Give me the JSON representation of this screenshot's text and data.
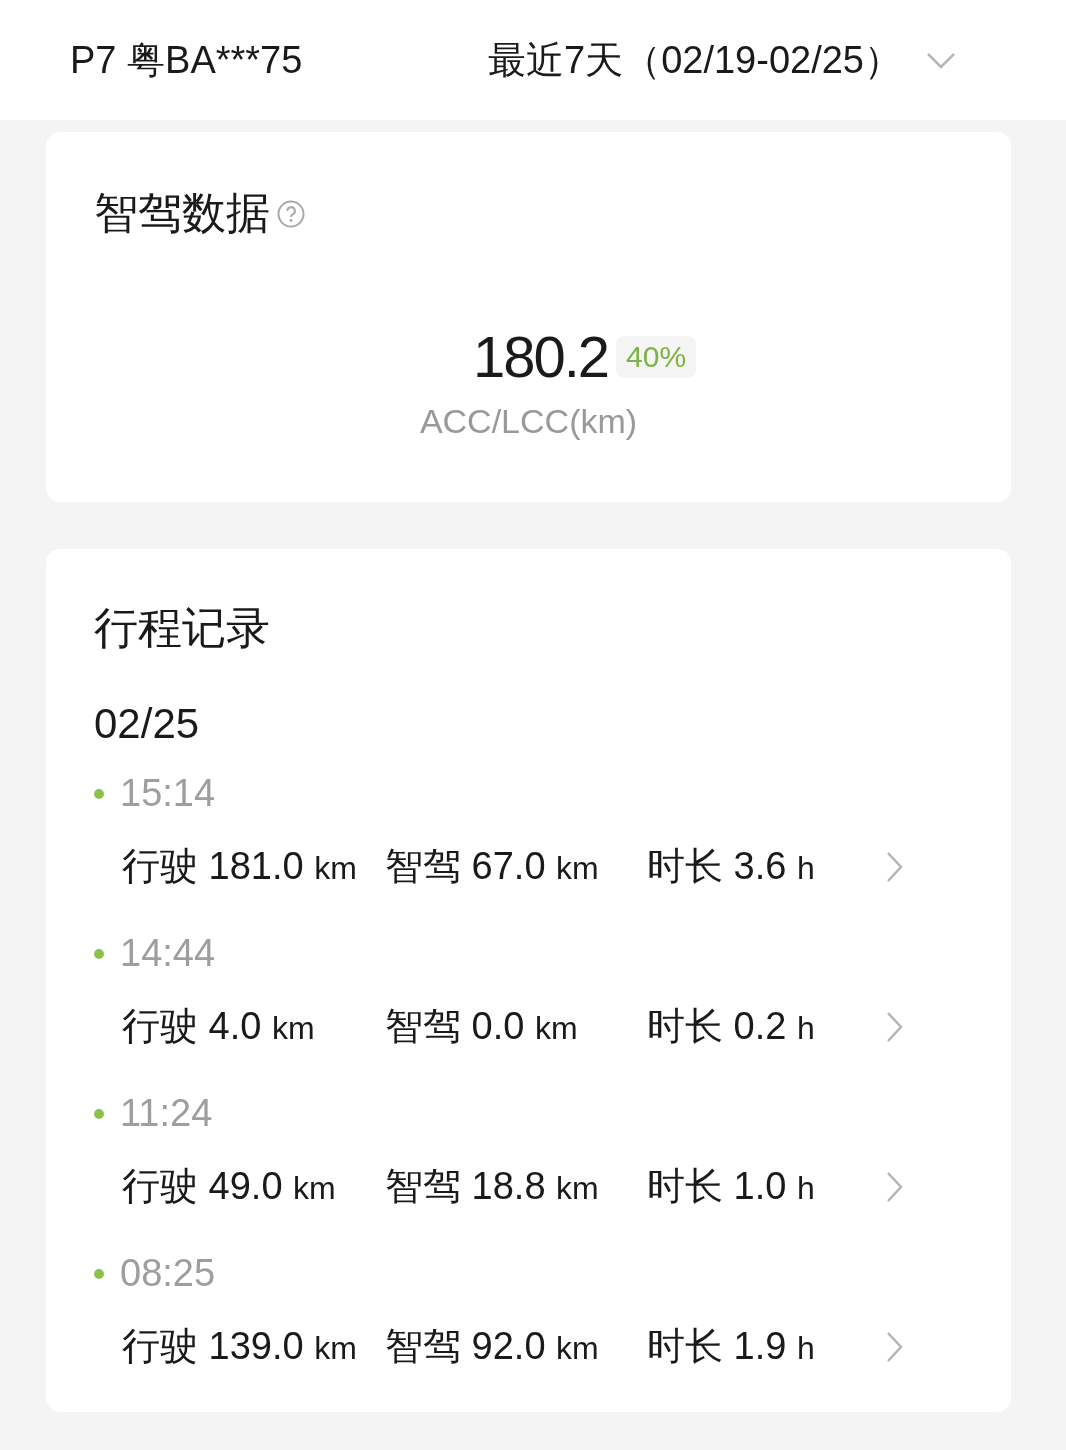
{
  "header": {
    "vehicle": "P7 粤BA***75",
    "period": "最近7天（02/19-02/25）"
  },
  "assist_card": {
    "title": "智驾数据",
    "value": "180.2",
    "percent": "40%",
    "caption": "ACC/LCC(km)"
  },
  "trips_card": {
    "title": "行程记录",
    "days": [
      {
        "date": "02/25",
        "trips": [
          {
            "time": "15:14",
            "stats": [
              {
                "label": "行驶",
                "value": "181.0",
                "unit": "km"
              },
              {
                "label": "智驾",
                "value": "67.0",
                "unit": "km"
              },
              {
                "label": "时长",
                "value": "3.6",
                "unit": "h"
              }
            ]
          },
          {
            "time": "14:44",
            "stats": [
              {
                "label": "行驶",
                "value": "4.0",
                "unit": "km"
              },
              {
                "label": "智驾",
                "value": "0.0",
                "unit": "km"
              },
              {
                "label": "时长",
                "value": "0.2",
                "unit": "h"
              }
            ]
          },
          {
            "time": "11:24",
            "stats": [
              {
                "label": "行驶",
                "value": "49.0",
                "unit": "km"
              },
              {
                "label": "智驾",
                "value": "18.8",
                "unit": "km"
              },
              {
                "label": "时长",
                "value": "1.0",
                "unit": "h"
              }
            ]
          },
          {
            "time": "08:25",
            "stats": [
              {
                "label": "行驶",
                "value": "139.0",
                "unit": "km"
              },
              {
                "label": "智驾",
                "value": "92.0",
                "unit": "km"
              },
              {
                "label": "时长",
                "value": "1.9",
                "unit": "h"
              }
            ]
          }
        ]
      }
    ]
  }
}
